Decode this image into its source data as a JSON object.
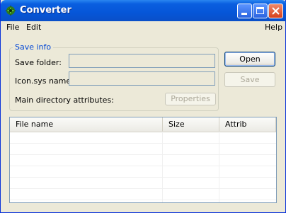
{
  "window": {
    "title": "Converter",
    "app_icon": "converter-app-icon"
  },
  "title_buttons": {
    "minimize": "minimize-icon",
    "maximize": "maximize-icon",
    "close": "close-icon"
  },
  "menu": {
    "file": "File",
    "edit": "Edit",
    "help": "Help"
  },
  "save_info": {
    "group_label": "Save info",
    "save_folder_label": "Save folder:",
    "save_folder_value": "",
    "icon_sys_label": "Icon.sys name:",
    "icon_sys_value": "",
    "main_dir_label": "Main directory attributes:",
    "properties_button": "Properties"
  },
  "buttons": {
    "open": "Open",
    "save": "Save"
  },
  "file_list": {
    "columns": [
      "File name",
      "Size",
      "Attrib"
    ],
    "rows": []
  },
  "colors": {
    "titlebar": "#0656d8",
    "group_label": "#0046d5",
    "window_bg": "#ece9d8"
  }
}
